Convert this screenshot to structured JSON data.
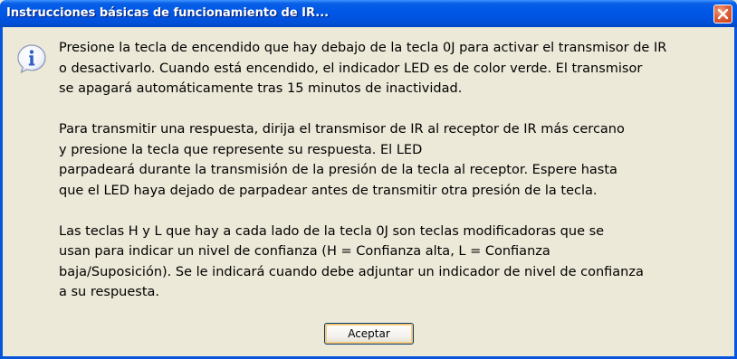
{
  "window": {
    "title": "Instrucciones básicas de funcionamiento de IR..."
  },
  "icons": {
    "message_icon": "information-icon",
    "close_icon": "close-icon"
  },
  "colors": {
    "titlebar": "#0054e3",
    "close_button": "#e0603a",
    "client_background": "#ece9d8",
    "info_icon": "#2f5ec7"
  },
  "message": {
    "paragraphs": [
      [
        "Presione la tecla de encendido que hay debajo de la tecla 0J para activar el transmisor de IR",
        "o desactivarlo. Cuando está encendido, el indicador LED es de color verde. El transmisor",
        "se apagará automáticamente tras 15 minutos de inactividad."
      ],
      [
        "Para transmitir una respuesta, dirija el transmisor de IR al receptor de IR más cercano",
        "y presione la tecla que represente su respuesta. El LED",
        "parpadeará durante la transmisión de la presión de la tecla al receptor. Espere hasta",
        "que el LED haya dejado de parpadear antes de transmitir otra presión de la tecla."
      ],
      [
        "Las teclas H y L que hay a cada lado de la tecla 0J son teclas modificadoras que se",
        "usan para indicar un nivel de confianza (H = Confianza alta, L = Confianza",
        "baja/Suposición). Se le indicará cuando debe adjuntar un indicador de nivel de confianza",
        "a su respuesta."
      ]
    ]
  },
  "buttons": {
    "ok_label": "Aceptar"
  }
}
